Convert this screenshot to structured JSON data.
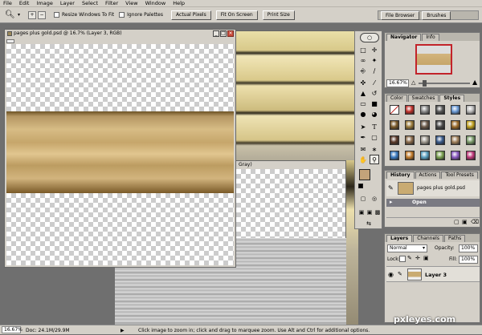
{
  "menu": [
    "File",
    "Edit",
    "Image",
    "Layer",
    "Select",
    "Filter",
    "View",
    "Window",
    "Help"
  ],
  "options": {
    "resize_label": "Resize Windows To Fit",
    "ignore_label": "Ignore Palettes",
    "actual_pixels": "Actual Pixels",
    "fit_on_screen": "Fit On Screen",
    "print_size": "Print Size",
    "well_tabs": [
      "File Browser",
      "Brushes"
    ]
  },
  "document": {
    "title": "pages plus gold.psd @ 16.7% (Layer 3, RGB)",
    "gray_title": "Gray)"
  },
  "navigator": {
    "tabs": [
      "Navigator",
      "Info"
    ],
    "zoom": "16.67%"
  },
  "styles": {
    "tabs": [
      "Color",
      "Swatches",
      "Styles"
    ]
  },
  "history": {
    "tabs": [
      "History",
      "Actions",
      "Tool Presets"
    ],
    "snapshot": "pages plus gold.psd",
    "step": "Open"
  },
  "layers": {
    "tabs": [
      "Layers",
      "Channels",
      "Paths"
    ],
    "blend": "Normal",
    "opacity_label": "Opacity:",
    "opacity": "100%",
    "lock_label": "Lock:",
    "fill_label": "Fill:",
    "fill": "100%",
    "layer_name": "Layer 3"
  },
  "status": {
    "zoom": "16.67%",
    "doc": "Doc: 24.1M/29.9M",
    "hint": "Click image to zoom in; click and drag to marquee zoom.  Use Alt and Ctrl for additional options."
  },
  "watermark": "pxleyes.com",
  "colors": {
    "foreground": "#c4a37a",
    "background": "#ffffff",
    "accent": "#8c1a1a"
  }
}
